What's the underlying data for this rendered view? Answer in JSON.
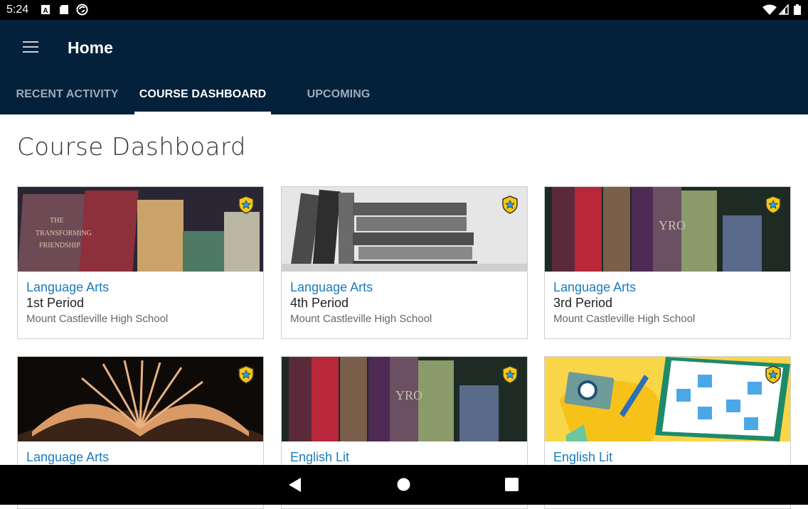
{
  "status_bar": {
    "time": "5:24",
    "left_icons": [
      "a-notification-icon",
      "sd-card-icon",
      "sync-icon"
    ],
    "right_icons": [
      "wifi-icon",
      "cell-signal-icon",
      "battery-icon"
    ]
  },
  "app_bar": {
    "menu_icon": "hamburger-menu-icon",
    "title": "Home",
    "tabs": [
      {
        "label": "RECENT ACTIVITY",
        "active": false
      },
      {
        "label": "COURSE DASHBOARD",
        "active": true
      },
      {
        "label": "UPCOMING",
        "active": false
      }
    ]
  },
  "main": {
    "heading": "Course Dashboard",
    "courses": [
      {
        "subject": "Language Arts",
        "period": "1st Period",
        "school": "Mount Castleville High School",
        "image": "colorful-old-books",
        "badge": "shield-star-icon"
      },
      {
        "subject": "Language Arts",
        "period": "4th Period",
        "school": "Mount Castleville High School",
        "image": "grayscale-book-stack",
        "badge": "shield-star-icon"
      },
      {
        "subject": "Language Arts",
        "period": "3rd Period",
        "school": "Mount Castleville High School",
        "image": "antique-book-spines",
        "badge": "shield-star-icon"
      },
      {
        "subject": "Language Arts",
        "period": "",
        "school": "",
        "image": "open-book-pages",
        "badge": "shield-star-icon"
      },
      {
        "subject": "English Lit",
        "period": "",
        "school": "",
        "image": "antique-book-spines",
        "badge": "shield-star-icon"
      },
      {
        "subject": "English Lit",
        "period": "",
        "school": "",
        "image": "illustrated-camera-pen-book",
        "badge": "shield-star-icon"
      }
    ]
  },
  "nav_bar": {
    "buttons": [
      "back-icon",
      "home-icon",
      "recents-icon"
    ]
  },
  "colors": {
    "app_bar": "#03213a",
    "link_blue": "#1a7bbf",
    "badge_yellow": "#f5c518",
    "badge_star": "#29a3e0"
  }
}
